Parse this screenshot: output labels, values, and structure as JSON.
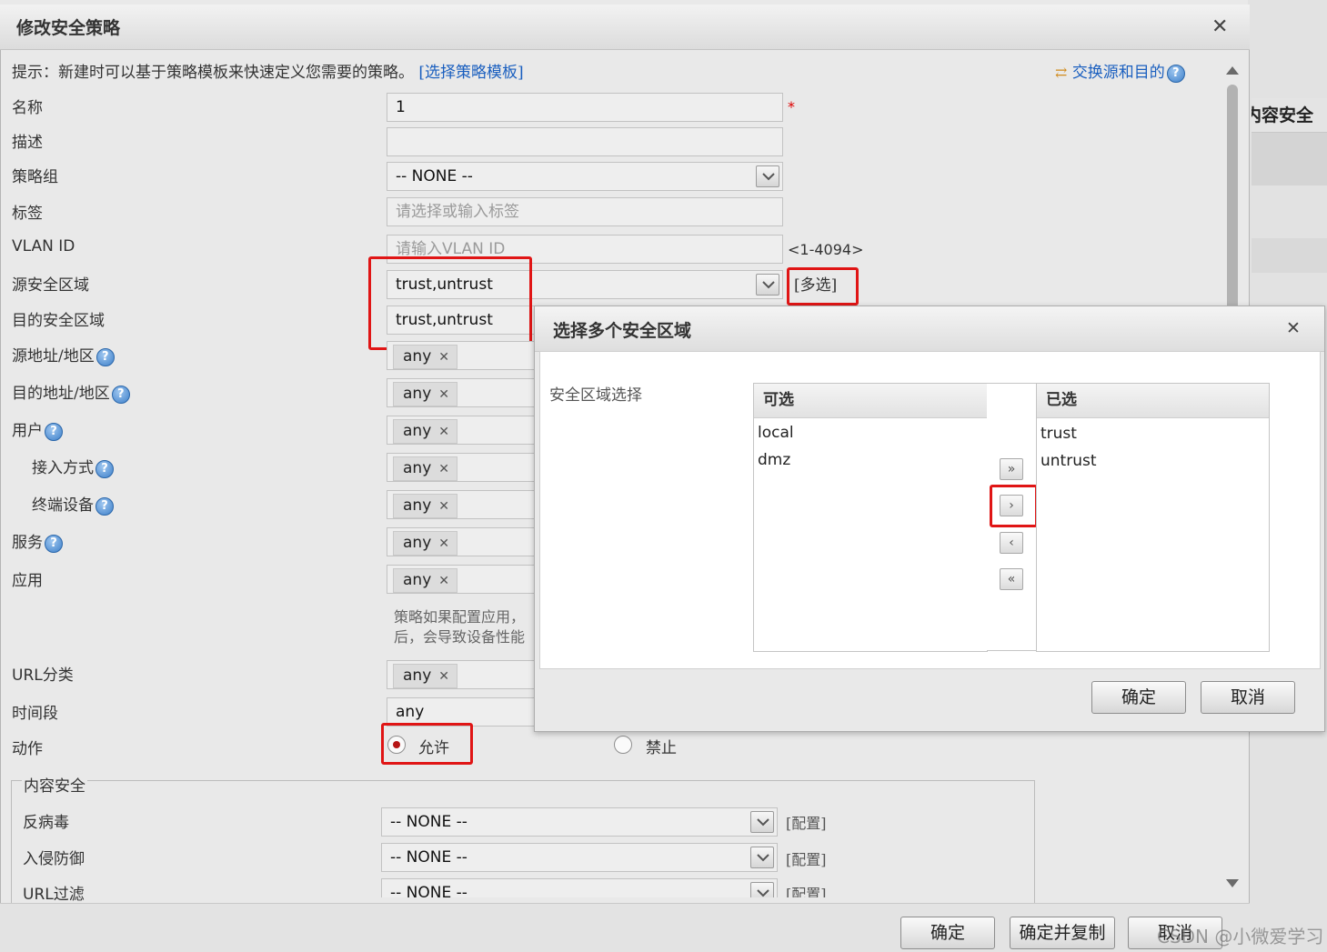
{
  "main_dialog": {
    "title": "修改安全策略",
    "hint_prefix": "提示：新建时可以基于策略模板来快速定义您需要的策略。",
    "template_link": "[选择策略模板]",
    "swap_link": "交换源和目的",
    "fields": {
      "name_label": "名称",
      "name_value": "1",
      "required_mark": "*",
      "desc_label": "描述",
      "desc_value": "",
      "group_label": "策略组",
      "group_value": "-- NONE --",
      "tag_label": "标签",
      "tag_placeholder": "请选择或输入标签",
      "vlan_label": "VLAN ID",
      "vlan_placeholder": "请输入VLAN ID",
      "vlan_range": "<1-4094>",
      "src_zone_label": "源安全区域",
      "src_zone_value": "trust,untrust",
      "multi_select_link": "[多选]",
      "dst_zone_label": "目的安全区域",
      "dst_zone_value": "trust,untrust",
      "src_addr_label": "源地址/地区",
      "dst_addr_label": "目的地址/地区",
      "user_label": "用户",
      "access_label": "接入方式",
      "terminal_label": "终端设备",
      "service_label": "服务",
      "app_label": "应用",
      "app_help_line1": "策略如果配置应用，",
      "app_help_line2": "后，会导致设备性能",
      "url_cat_label": "URL分类",
      "time_label": "时间段",
      "time_value": "any",
      "action_label": "动作",
      "action_permit": "允许",
      "action_deny": "禁止",
      "any_chip": "any",
      "chip_remove": "✕"
    },
    "content_security": {
      "legend": "内容安全",
      "antivirus_label": "反病毒",
      "antivirus_value": "-- NONE --",
      "ips_label": "入侵防御",
      "ips_value": "-- NONE --",
      "url_filter_label": "URL过滤",
      "url_filter_value": "-- NONE --",
      "config_link": "[配置]"
    },
    "footer": {
      "ok": "确定",
      "ok_copy": "确定并复制",
      "cancel": "取消"
    }
  },
  "background_tab": "内容安全",
  "zone_dialog": {
    "title": "选择多个安全区域",
    "field_label": "安全区域选择",
    "available_header": "可选",
    "selected_header": "已选",
    "available": [
      "local",
      "dmz"
    ],
    "selected": [
      "trust",
      "untrust"
    ],
    "move_all_right": "»",
    "move_right": "›",
    "move_left": "‹",
    "move_all_left": "«",
    "ok": "确定",
    "cancel": "取消"
  },
  "watermark": "CSDN @小微爱学习",
  "colors": {
    "highlight_red": "#e01515",
    "link_blue": "#1a5fbf",
    "radio_dot": "#b51414"
  },
  "icons": [
    "close-icon",
    "swap-icon",
    "help-icon",
    "dropdown-arrow-icon",
    "scroll-up-icon",
    "scroll-down-icon"
  ]
}
